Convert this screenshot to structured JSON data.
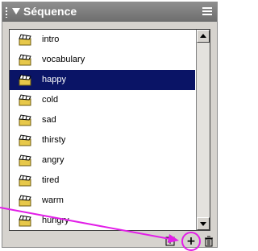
{
  "panel": {
    "title": "Séquence"
  },
  "list": {
    "items": [
      {
        "label": "intro",
        "selected": false
      },
      {
        "label": "vocabulary",
        "selected": false
      },
      {
        "label": "happy",
        "selected": true
      },
      {
        "label": "cold",
        "selected": false
      },
      {
        "label": "sad",
        "selected": false
      },
      {
        "label": "thirsty",
        "selected": false
      },
      {
        "label": "angry",
        "selected": false
      },
      {
        "label": "tired",
        "selected": false
      },
      {
        "label": "warm",
        "selected": false
      },
      {
        "label": "hungry",
        "selected": false
      }
    ]
  },
  "toolbar": {
    "add_label": "+",
    "delete_icon": "trash-icon",
    "new_folder_icon": "new-scene-icon"
  },
  "colors": {
    "selection": "#0a1466",
    "highlight": "#e21ee8"
  }
}
